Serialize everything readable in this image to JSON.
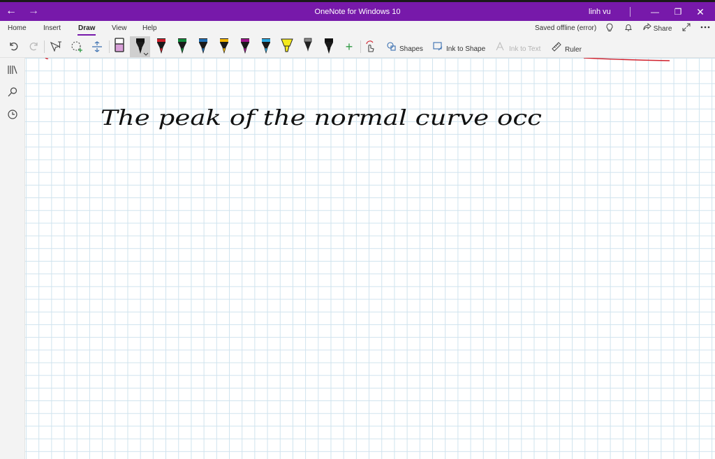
{
  "window": {
    "title": "OneNote for Windows 10",
    "user": "linh vu",
    "back_glyph": "←",
    "forward_glyph": "→",
    "minimize_glyph": "—",
    "maximize_glyph": "❐",
    "close_glyph": "✕"
  },
  "ribbon": {
    "tabs": [
      "Home",
      "Insert",
      "Draw",
      "View",
      "Help"
    ],
    "active_tab": "Draw",
    "status": "Saved offline (error)",
    "share_label": "Share",
    "accent_color": "#7719aa"
  },
  "toolbar": {
    "shapes_label": "Shapes",
    "ink_to_shape_label": "Ink to Shape",
    "ink_to_text_label": "Ink to Text",
    "ruler_label": "Ruler",
    "pens": [
      {
        "kind": "eraser",
        "color": "#d8a0d8"
      },
      {
        "kind": "pen",
        "color": "#111111",
        "selected": true
      },
      {
        "kind": "pen",
        "color": "#d01f2b"
      },
      {
        "kind": "pen",
        "color": "#128a3c"
      },
      {
        "kind": "pen",
        "color": "#1f6fb5"
      },
      {
        "kind": "pen",
        "color": "#f2b600"
      },
      {
        "kind": "pen",
        "color": "#a0168c"
      },
      {
        "kind": "pen",
        "color": "#2aa8e0"
      },
      {
        "kind": "highlighter",
        "color": "#f5ea1e"
      },
      {
        "kind": "pencil",
        "color": "#8a8a8a"
      },
      {
        "kind": "pen",
        "color": "#111111"
      }
    ]
  },
  "page": {
    "handwriting": "The peak of the normal curve occ",
    "ink_color": "#111111"
  }
}
